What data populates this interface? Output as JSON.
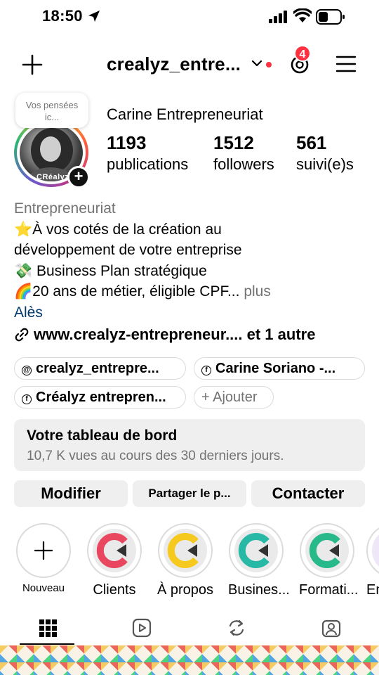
{
  "status_bar": {
    "time": "18:50"
  },
  "header": {
    "username": "crealyz_entre...",
    "notifications_badge": "4"
  },
  "profile": {
    "note": "Vos pensées ic...",
    "full_name": "Carine Entrepreneuriat",
    "avatar_brand": "CRéalyz",
    "stats": [
      {
        "value": "1193",
        "label": "publications"
      },
      {
        "value": "1512",
        "label": "followers"
      },
      {
        "value": "561",
        "label": "suivi(e)s"
      }
    ]
  },
  "bio": {
    "category": "Entrepreneuriat",
    "lines": [
      "⭐À vos cotés de la création au",
      "développement de votre entreprise",
      "💸 Business Plan stratégique",
      "🌈20 ans de métier, éligible CPF..."
    ],
    "more": " plus",
    "location": "Alès",
    "link": "www.crealyz-entrepreneur....",
    "link_more": " et 1 autre"
  },
  "chips": [
    {
      "icon": "threads-icon",
      "label": "crealyz_entrepre..."
    },
    {
      "icon": "facebook-icon",
      "label": "Carine Soriano -..."
    },
    {
      "icon": "facebook-icon",
      "label": "Créalyz entrepren..."
    },
    {
      "icon": "plus-icon",
      "label": "+ Ajouter"
    }
  ],
  "dashboard": {
    "title": "Votre tableau de bord",
    "subtitle": "10,7 K vues au cours des 30 derniers jours."
  },
  "actions": {
    "edit": "Modifier",
    "share": "Partager le p...",
    "contact": "Contacter"
  },
  "highlights": [
    {
      "label": "Nouveau",
      "color": "#ffffff"
    },
    {
      "label": "Clients",
      "color": "#e8475f"
    },
    {
      "label": "À propos",
      "color": "#f6c91e"
    },
    {
      "label": "Busines...",
      "color": "#27b9a6"
    },
    {
      "label": "Formati...",
      "color": "#27b98a"
    },
    {
      "label": "En",
      "color": "#b38be0"
    }
  ]
}
